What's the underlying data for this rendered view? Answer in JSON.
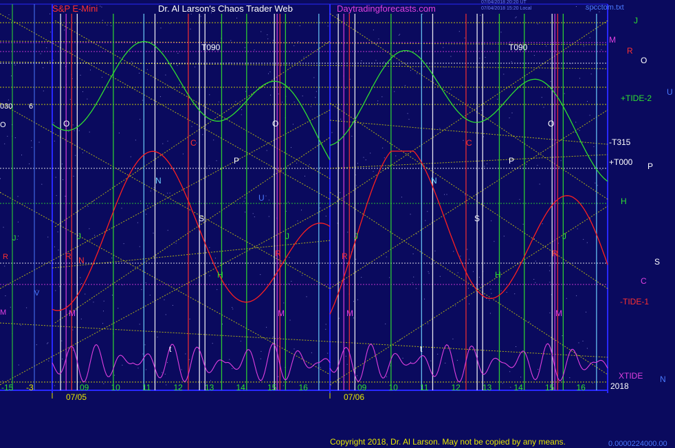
{
  "header": {
    "symbol": "S&P E-Mini",
    "site_title": "Dr. Al Larson's Chaos Trader Web",
    "website": "Daytradingforecasts.com",
    "stamp1": "07/04/2018 20:20 UT",
    "stamp2": "07/04/2018 15:20 Local",
    "file": "spcctom.txt",
    "copyright": "Copyright 2018, Dr. Al Larson. May not be copied by any means.",
    "footer_value": "0.0000224000.00"
  },
  "colors": {
    "background": "#0a0a5e",
    "green_line": "#30e030",
    "red_line": "#ff2020",
    "magenta_line": "#e040e0",
    "yellow_dots": "#e8e800",
    "frame_blue": "#2828ff"
  },
  "chart_data": {
    "type": "line",
    "series": [
      {
        "name": "+TIDE-2"
      },
      {
        "name": "-TIDE-1"
      },
      {
        "name": "XTIDE"
      }
    ],
    "panels": [
      {
        "date": "07/05",
        "hours": [
          "09",
          "10",
          "11",
          "12",
          "13",
          "14",
          "15",
          "16"
        ]
      },
      {
        "date": "07/06",
        "hours": [
          "09",
          "10",
          "11",
          "12",
          "13",
          "14",
          "15",
          "16"
        ]
      }
    ],
    "left_partial_hours": [
      "-15",
      "-3"
    ],
    "left_labels": {
      "t030": "030",
      "six": "6",
      "o": "O",
      "j": "J",
      "r": "R",
      "m": "M",
      "v": "V"
    },
    "right_legend": [
      "J",
      "M",
      "R",
      "O",
      "U",
      "+TIDE-2",
      "-T315",
      "+T000",
      "P",
      "H",
      "S",
      "C",
      "-TIDE-1",
      "XTIDE",
      "N"
    ],
    "year_label": "2018",
    "chart_annotations": {
      "t090": "T090",
      "o": "O",
      "c": "C",
      "p": "P",
      "n": "N",
      "s": "S",
      "h": "H",
      "j": "J",
      "r": "R",
      "m": "M",
      "u": "U",
      "t": "t"
    }
  }
}
